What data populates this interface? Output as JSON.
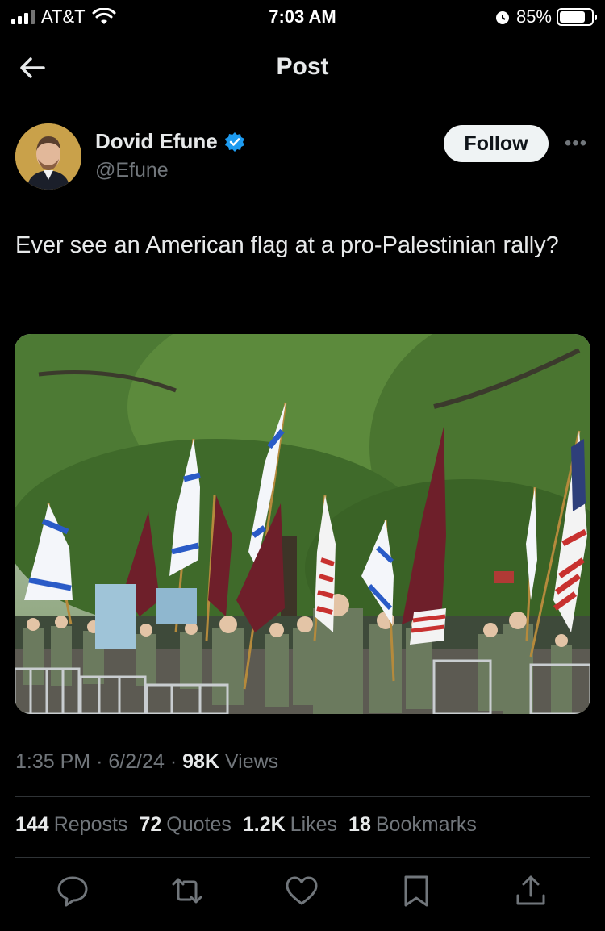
{
  "status_bar": {
    "carrier": "AT&T",
    "time": "7:03 AM",
    "battery": "85%"
  },
  "header": {
    "title": "Post"
  },
  "author": {
    "name": "Dovid Efune",
    "handle": "@Efune",
    "verified": true,
    "follow_label": "Follow"
  },
  "tweet": {
    "text": "Ever see an American flag at a pro-Palestinian rally?"
  },
  "meta": {
    "time": "1:35 PM",
    "date": "6/2/24",
    "views_count": "98K",
    "views_label": "Views"
  },
  "stats": {
    "reposts_count": "144",
    "reposts_label": "Reposts",
    "quotes_count": "72",
    "quotes_label": "Quotes",
    "likes_count": "1.2K",
    "likes_label": "Likes",
    "bookmarks_count": "18",
    "bookmarks_label": "Bookmarks"
  },
  "icons": {
    "back": "arrow-left-icon",
    "verified": "verified-badge-icon",
    "more": "more-horizontal-icon",
    "reply": "reply-icon",
    "repost": "repost-icon",
    "like": "heart-icon",
    "bookmark": "bookmark-icon",
    "share": "share-icon"
  },
  "colors": {
    "background": "#000000",
    "text": "#e7e9ea",
    "muted": "#71767b",
    "verified": "#1d9bf0",
    "divider": "#2f3336"
  }
}
